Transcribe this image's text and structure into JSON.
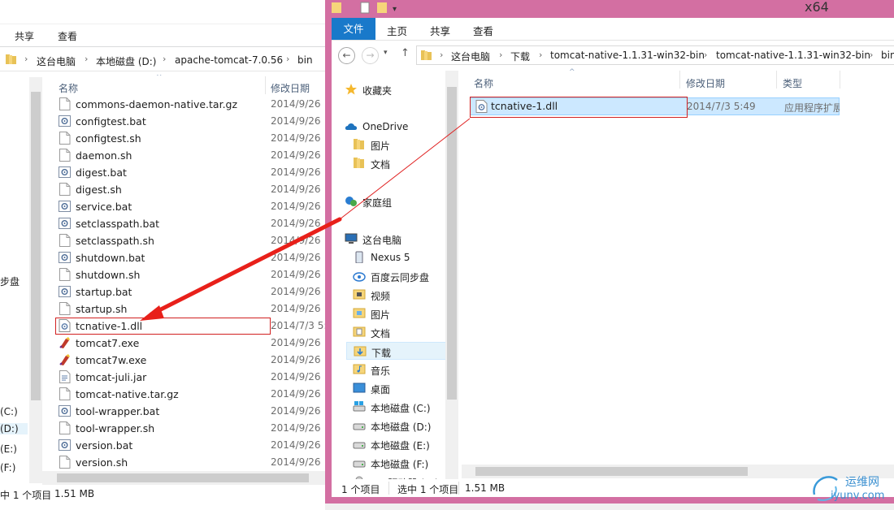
{
  "left_window": {
    "ribbon_tabs": [
      "共享",
      "查看"
    ],
    "breadcrumb": [
      "这台电脑",
      "本地磁盘 (D:)",
      "apache-tomcat-7.0.56",
      "bin"
    ],
    "nav_fragments": [
      "步盘",
      "(C:)",
      "(D:)",
      "(E:)",
      "(F:)"
    ],
    "columns": {
      "name": "名称",
      "date": "修改日期"
    },
    "files": [
      {
        "name": "commons-daemon-native.tar.gz",
        "date": "2014/9/26",
        "icon": "file-icon"
      },
      {
        "name": "configtest.bat",
        "date": "2014/9/26",
        "icon": "bat-icon"
      },
      {
        "name": "configtest.sh",
        "date": "2014/9/26",
        "icon": "file-icon"
      },
      {
        "name": "daemon.sh",
        "date": "2014/9/26",
        "icon": "file-icon"
      },
      {
        "name": "digest.bat",
        "date": "2014/9/26",
        "icon": "bat-icon"
      },
      {
        "name": "digest.sh",
        "date": "2014/9/26",
        "icon": "file-icon"
      },
      {
        "name": "service.bat",
        "date": "2014/9/26",
        "icon": "bat-icon"
      },
      {
        "name": "setclasspath.bat",
        "date": "2014/9/26",
        "icon": "bat-icon"
      },
      {
        "name": "setclasspath.sh",
        "date": "2014/9/26",
        "icon": "file-icon"
      },
      {
        "name": "shutdown.bat",
        "date": "2014/9/26",
        "icon": "bat-icon"
      },
      {
        "name": "shutdown.sh",
        "date": "2014/9/26",
        "icon": "file-icon"
      },
      {
        "name": "startup.bat",
        "date": "2014/9/26",
        "icon": "bat-icon"
      },
      {
        "name": "startup.sh",
        "date": "2014/9/26",
        "icon": "file-icon"
      },
      {
        "name": "tcnative-1.dll",
        "date": "2014/7/3 5:",
        "icon": "dll-icon"
      },
      {
        "name": "tomcat7.exe",
        "date": "2014/9/26",
        "icon": "exe-icon"
      },
      {
        "name": "tomcat7w.exe",
        "date": "2014/9/26",
        "icon": "exe-icon"
      },
      {
        "name": "tomcat-juli.jar",
        "date": "2014/9/26",
        "icon": "jar-icon"
      },
      {
        "name": "tomcat-native.tar.gz",
        "date": "2014/9/26",
        "icon": "file-icon"
      },
      {
        "name": "tool-wrapper.bat",
        "date": "2014/9/26",
        "icon": "bat-icon"
      },
      {
        "name": "tool-wrapper.sh",
        "date": "2014/9/26",
        "icon": "file-icon"
      },
      {
        "name": "version.bat",
        "date": "2014/9/26",
        "icon": "bat-icon"
      },
      {
        "name": "version.sh",
        "date": "2014/9/26",
        "icon": "file-icon"
      }
    ],
    "status": {
      "selected": "中 1 个项目",
      "size": "1.51 MB"
    }
  },
  "right_window": {
    "title": "x64",
    "ribbon_tabs": {
      "file": "文件",
      "home": "主页",
      "share": "共享",
      "view": "查看"
    },
    "breadcrumb": [
      "这台电脑",
      "下载",
      "tomcat-native-1.1.31-win32-bin",
      "tomcat-native-1.1.31-win32-bin",
      "bin"
    ],
    "nav_items": [
      {
        "label": "收藏夹",
        "icon": "star-icon"
      },
      {
        "label": "OneDrive",
        "icon": "cloud-icon"
      },
      {
        "label": "图片",
        "icon": "folder-icon"
      },
      {
        "label": "文档",
        "icon": "folder-icon"
      },
      {
        "label": "家庭组",
        "icon": "homegroup-icon"
      },
      {
        "label": "这台电脑",
        "icon": "computer-icon"
      },
      {
        "label": "Nexus 5",
        "icon": "phone-icon"
      },
      {
        "label": "百度云同步盘",
        "icon": "sync-drive-icon"
      },
      {
        "label": "视频",
        "icon": "video-folder-icon"
      },
      {
        "label": "图片",
        "icon": "pictures-folder-icon"
      },
      {
        "label": "文档",
        "icon": "documents-folder-icon"
      },
      {
        "label": "下载",
        "icon": "downloads-folder-icon"
      },
      {
        "label": "音乐",
        "icon": "music-folder-icon"
      },
      {
        "label": "桌面",
        "icon": "desktop-folder-icon"
      },
      {
        "label": "本地磁盘 (C:)",
        "icon": "system-drive-icon"
      },
      {
        "label": "本地磁盘 (D:)",
        "icon": "drive-icon"
      },
      {
        "label": "本地磁盘 (E:)",
        "icon": "drive-icon"
      },
      {
        "label": "本地磁盘 (F:)",
        "icon": "drive-icon"
      },
      {
        "label": "CD 驱动器 (H:)",
        "icon": "cd-drive-icon"
      }
    ],
    "columns": {
      "name": "名称",
      "date": "修改日期",
      "type": "类型"
    },
    "file": {
      "name": "tcnative-1.dll",
      "date": "2014/7/3 5:49",
      "type": "应用程序扩展"
    },
    "status": {
      "count": "1 个项目",
      "selected": "选中 1 个项目",
      "size": "1.51 MB"
    }
  },
  "watermark": {
    "line1": "运维网",
    "line2": "iyunv.com"
  },
  "colors": {
    "window_border": "#d36fa2",
    "file_tab": "#1979ca",
    "selection": "#cce8ff",
    "annotation_red": "#e02020"
  }
}
